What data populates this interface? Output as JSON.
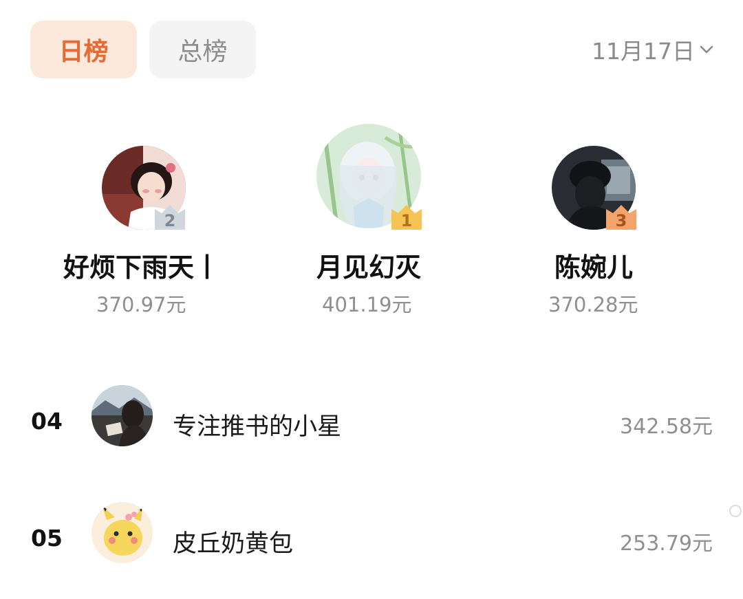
{
  "tabs": {
    "daily": "日榜",
    "total": "总榜"
  },
  "date": {
    "label": "11月17日",
    "icon": "chevron-down-icon"
  },
  "podium": [
    {
      "rank": "2",
      "name": "好烦下雨天丨",
      "amount": "370.97元"
    },
    {
      "rank": "1",
      "name": "月见幻灭",
      "amount": "401.19元"
    },
    {
      "rank": "3",
      "name": "陈婉儿",
      "amount": "370.28元"
    }
  ],
  "list": [
    {
      "rank": "04",
      "name": "专注推书的小星",
      "amount": "342.58元"
    },
    {
      "rank": "05",
      "name": "皮丘奶黄包",
      "amount": "253.79元"
    }
  ],
  "colors": {
    "accent": "#e76a34",
    "accent_bg": "#fde8dc",
    "muted": "#8f8f8f",
    "gold_badge": "#f6c453",
    "silver_badge": "#cfd6dd",
    "bronze_badge": "#f3a46b"
  }
}
